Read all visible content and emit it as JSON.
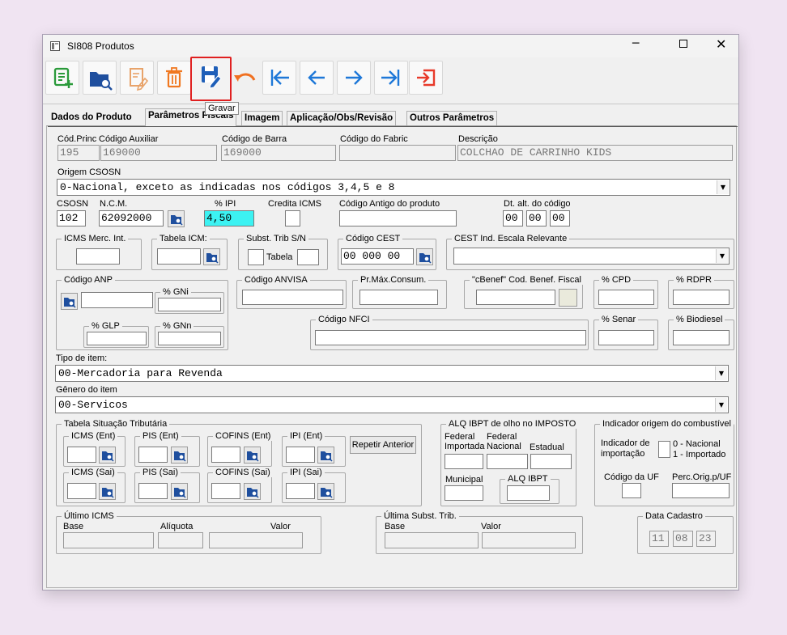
{
  "window": {
    "title": "SI808 Produtos"
  },
  "toolbar": {
    "tooltip": "Gravar"
  },
  "tabs": [
    "Dados do  Produto",
    "Parâmetros Fiscais",
    "Imagem",
    "Aplicação/Obs/Revisão",
    "Outros Parâmetros"
  ],
  "row1": {
    "cod_princ_label": "Cód.Princ",
    "cod_princ": "195",
    "cod_aux_label": "Código Auxiliar",
    "cod_aux": "169000",
    "cod_barra_label": "Código de Barra",
    "cod_barra": "169000",
    "cod_fabric_label": "Código do Fabric",
    "cod_fabric": "",
    "descricao_label": "Descrição",
    "descricao": "COLCHAO DE CARRINHO KIDS"
  },
  "origem": {
    "label": "Origem CSOSN",
    "value": "0-Nacional, exceto as indicadas nos códigos 3,4,5 e 8"
  },
  "row3": {
    "csosn_label": "CSOSN",
    "csosn": "102",
    "ncm_label": "N.C.M.",
    "ncm": "62092000",
    "ipi_label": "% IPI",
    "ipi": "4,50",
    "credita_label": "Credita ICMS",
    "cod_antigo_label": "Código Antigo do produto",
    "dt_alt_label": "Dt. alt. do código",
    "dt_d": "00",
    "dt_m": "00",
    "dt_y": "00"
  },
  "row4": {
    "icms_merc": "ICMS Merc. Int.",
    "tabela_icm": "Tabela ICM:",
    "subst_trib": "Subst. Trib S/N",
    "tabela": "Tabela",
    "cod_cest": "Código CEST",
    "cest_value": "00 000 00",
    "cest_ind": "CEST Ind. Escala Relevante"
  },
  "row5": {
    "anp": "Código ANP",
    "gni": "% GNi",
    "glp": "% GLP",
    "gnn": "% GNn",
    "anvisa": "Código ANVISA",
    "pr_max": "Pr.Máx.Consum.",
    "cbenef": "\"cBenef\" Cod. Benef. Fiscal",
    "cpd": "% CPD",
    "rdpr": "% RDPR",
    "nfci": "Código NFCI",
    "senar": "% Senar",
    "biodiesel": "% Biodiesel"
  },
  "tipo_item": {
    "label": "Tipo de item:",
    "value": "00-Mercadoria para Revenda"
  },
  "genero": {
    "label": "Gênero do item",
    "value": "00-Servicos"
  },
  "tst": {
    "title": "Tabela Situação Tributária",
    "icms_ent": "ICMS (Ent)",
    "pis_ent": "PIS (Ent)",
    "cofins_ent": "COFINS (Ent)",
    "ipi_ent": "IPI (Ent)",
    "icms_sai": "ICMS (Sai)",
    "pis_sai": "PIS (Sai)",
    "cofins_sai": "COFINS (Sai)",
    "ipi_sai": "IPI (Sai)",
    "repetir": "Repetir Anterior"
  },
  "ibpt": {
    "title": "ALQ IBPT de olho no IMPOSTO",
    "fed_imp": "Federal\nImportada",
    "fed_nac": "Federal\nNacional",
    "estadual": "Estadual",
    "municipal": "Municipal",
    "alq": "ALQ IBPT"
  },
  "comb": {
    "title": "Indicador origem do combustível",
    "ind_imp": "Indicador de\nimportação",
    "opt0": "0 - Nacional",
    "opt1": "1 - Importado",
    "cod_uf": "Código da UF",
    "perc": "Perc.Orig.p/UF"
  },
  "ultimo_icms": {
    "title": "Último ICMS",
    "base": "Base",
    "aliquota": "Alíquota",
    "valor": "Valor"
  },
  "ultima_subst": {
    "title": "Última Subst. Trib.",
    "base": "Base",
    "valor": "Valor"
  },
  "data_cad": {
    "title": "Data Cadastro",
    "d": "11",
    "m": "08",
    "y": "23"
  }
}
